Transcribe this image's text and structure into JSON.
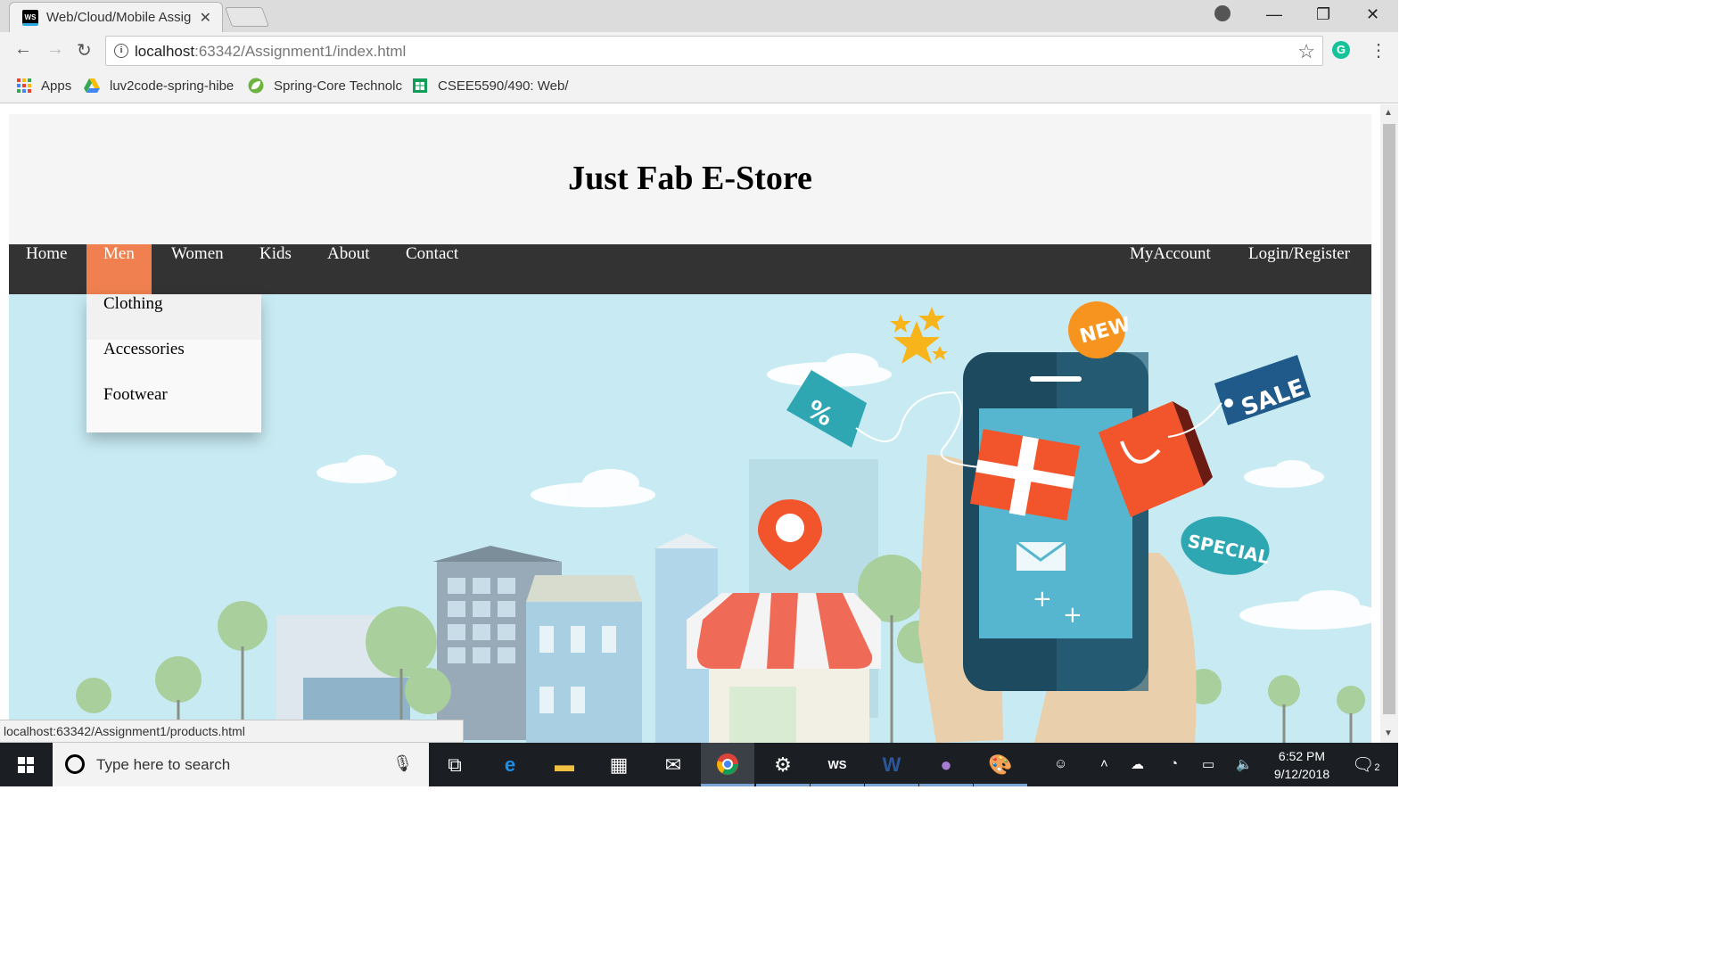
{
  "browser": {
    "tab_title": "Web/Cloud/Mobile Assig",
    "tab_favicon": "WS",
    "url_host": "localhost",
    "url_rest": ":63342/Assignment1/index.html",
    "bookmarks": [
      {
        "label": "Apps",
        "icon": "apps-grid-icon"
      },
      {
        "label": "luv2code-spring-hibe",
        "icon": "google-drive-icon"
      },
      {
        "label": "Spring-Core Technolc",
        "icon": "spring-leaf-icon"
      },
      {
        "label": "CSEE5590/490: Web/",
        "icon": "sheets-icon"
      }
    ],
    "status_url": "localhost:63342/Assignment1/products.html"
  },
  "site": {
    "title": "Just Fab E-Store",
    "nav_left": [
      "Home",
      "Men",
      "Women",
      "Kids",
      "About",
      "Contact"
    ],
    "nav_right": [
      "MyAccount",
      "Login/Register"
    ],
    "active_nav": "Men",
    "dropdown": [
      "Clothing",
      "Accessories",
      "Footwear"
    ],
    "hero_labels": {
      "new": "NEW",
      "sale": "SALE",
      "special": "SPECIAL",
      "percent": "%"
    }
  },
  "taskbar": {
    "search_placeholder": "Type here to search",
    "time": "6:52 PM",
    "date": "9/12/2018",
    "notification_count": "2"
  },
  "colors": {
    "navbar": "#333333",
    "nav_active": "#f0804f",
    "hero_bg": "#c8ebf3",
    "header_bg": "#f5f5f5"
  }
}
